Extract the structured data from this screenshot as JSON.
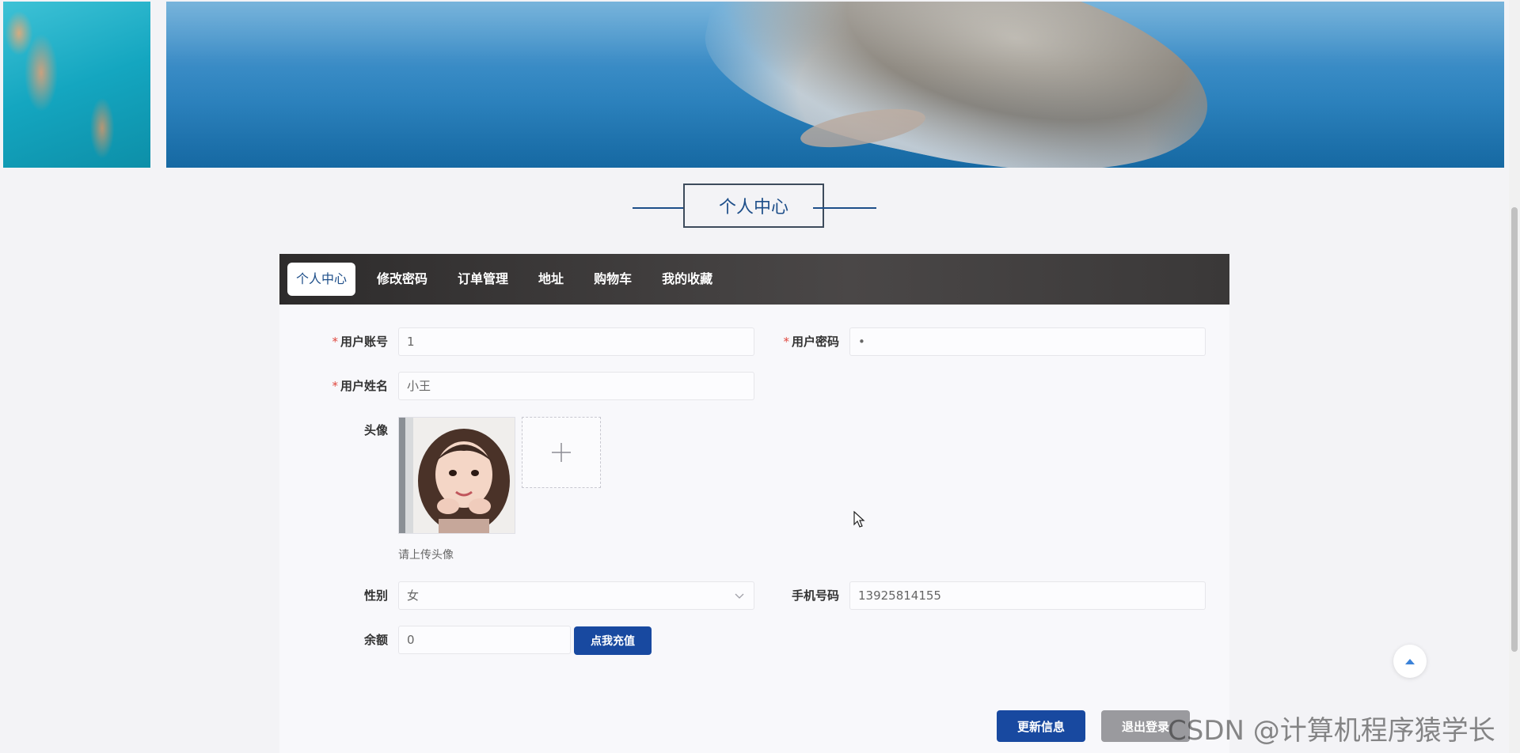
{
  "page_title": "个人中心",
  "tabs": [
    {
      "label": "个人中心",
      "active": true
    },
    {
      "label": "修改密码",
      "active": false
    },
    {
      "label": "订单管理",
      "active": false
    },
    {
      "label": "地址",
      "active": false
    },
    {
      "label": "购物车",
      "active": false
    },
    {
      "label": "我的收藏",
      "active": false
    }
  ],
  "form": {
    "account_label": "用户账号",
    "account_value": "1",
    "password_label": "用户密码",
    "password_value": "•",
    "name_label": "用户姓名",
    "name_value": "小王",
    "avatar_label": "头像",
    "avatar_hint": "请上传头像",
    "gender_label": "性别",
    "gender_value": "女",
    "phone_label": "手机号码",
    "phone_value": "13925814155",
    "balance_label": "余额",
    "balance_value": "0",
    "required_mark": "*"
  },
  "buttons": {
    "recharge": "点我充值",
    "update": "更新信息",
    "logout": "退出登录"
  },
  "watermark": "CSDN @计算机程序猿学长",
  "colors": {
    "primary": "#1849a0",
    "title_blue": "#1d4e89",
    "tabbar_dark": "#3a3838",
    "required_red": "#e0483f"
  }
}
